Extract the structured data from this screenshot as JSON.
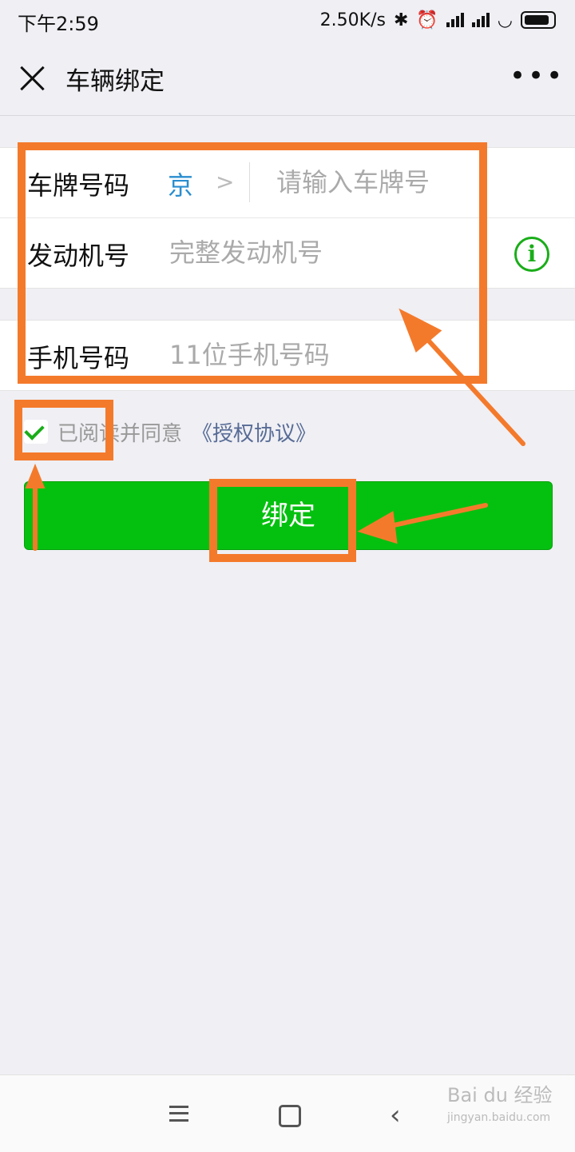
{
  "status_bar": {
    "time": "下午2:59",
    "speed": "2.50K/s"
  },
  "header": {
    "title": "车辆绑定"
  },
  "form": {
    "plate": {
      "label": "车牌号码",
      "province": "京",
      "placeholder": "请输入车牌号"
    },
    "engine": {
      "label": "发动机号",
      "placeholder": "完整发动机号"
    },
    "phone": {
      "label": "手机号码",
      "placeholder": "11位手机号码"
    }
  },
  "agreement": {
    "checked": true,
    "text": "已阅读并同意",
    "link": "《授权协议》"
  },
  "bind_button": {
    "label": "绑定"
  },
  "colors": {
    "primary_green": "#05c10f",
    "highlight_orange": "#f47a2b",
    "link_blue": "#576b95"
  },
  "icons": [
    "close-icon",
    "more-icon",
    "info-icon",
    "check-icon",
    "chevron-right-icon",
    "menu-icon",
    "home-icon",
    "back-icon"
  ],
  "watermark": {
    "brand": "Bai du 经验",
    "url": "jingyan.baidu.com"
  }
}
